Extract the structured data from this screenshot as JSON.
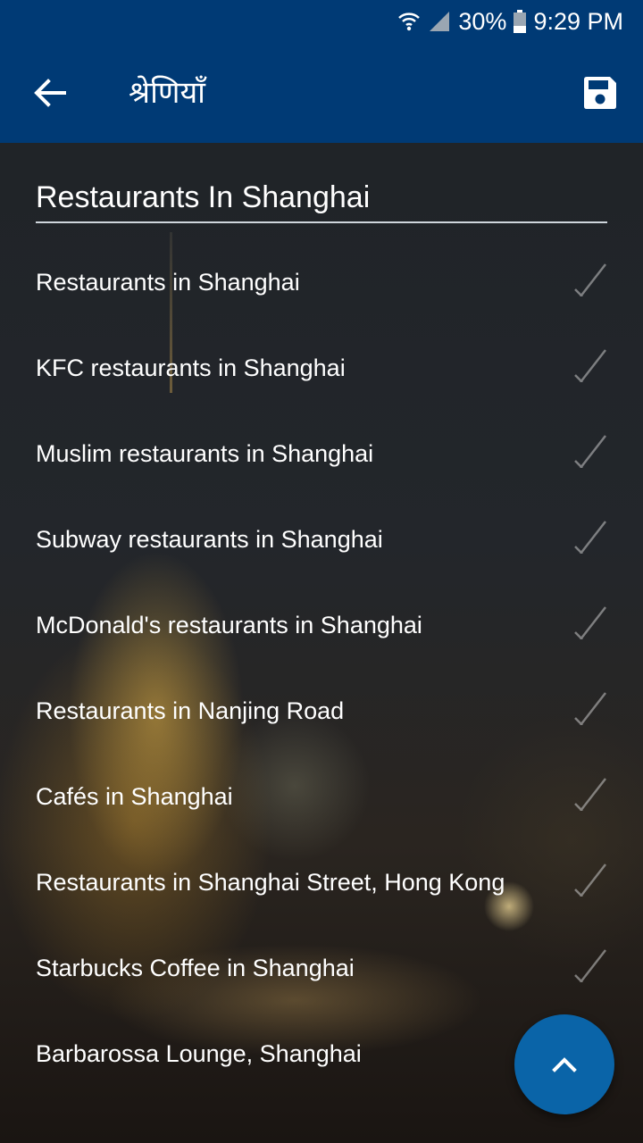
{
  "status_bar": {
    "battery": "30%",
    "time": "9:29 PM",
    "icons": [
      "wifi-icon",
      "signal-icon",
      "battery-icon"
    ]
  },
  "app_bar": {
    "title": "श्रेणियाँ",
    "back_icon": "arrow-left-icon",
    "save_icon": "save-icon"
  },
  "section": {
    "title": "Restaurants In Shanghai"
  },
  "items": [
    {
      "label": "Restaurants in Shanghai"
    },
    {
      "label": "KFC restaurants in Shanghai"
    },
    {
      "label": "Muslim restaurants in Shanghai"
    },
    {
      "label": "Subway restaurants in Shanghai"
    },
    {
      "label": "McDonald's restaurants in Shanghai"
    },
    {
      "label": "Restaurants in Nanjing Road"
    },
    {
      "label": "Cafés in Shanghai"
    },
    {
      "label": "Restaurants in Shanghai Street, Hong Kong"
    },
    {
      "label": "Starbucks Coffee in Shanghai"
    },
    {
      "label": "Barbarossa Lounge, Shanghai"
    }
  ],
  "fab": {
    "icon": "chevron-up-icon"
  },
  "colors": {
    "app_bar": "#003a75",
    "fab": "#0a64a8",
    "text": "#ffffff",
    "divider": "#cfd6dc"
  }
}
